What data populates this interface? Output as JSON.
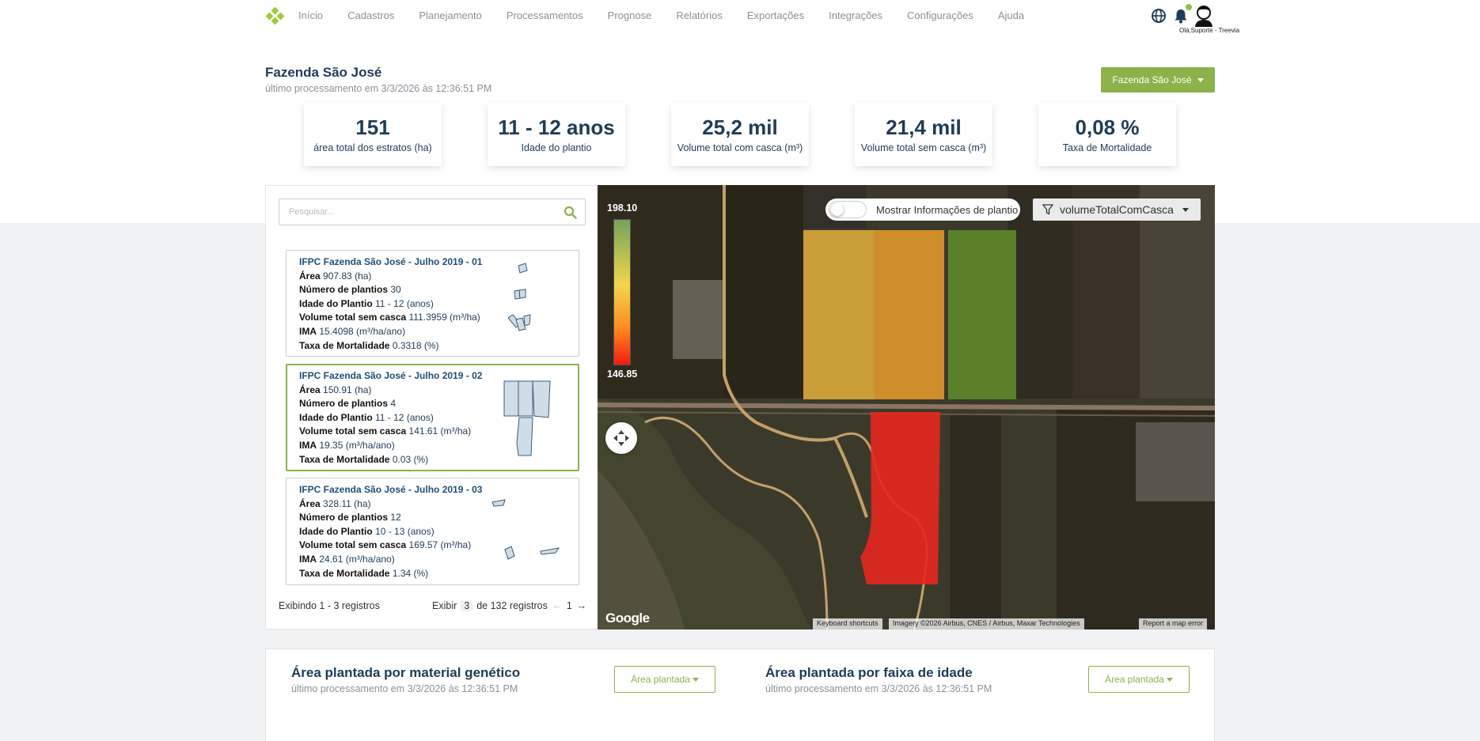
{
  "nav": {
    "items": [
      "Início",
      "Cadastros",
      "Planejamento",
      "Processamentos",
      "Prognose",
      "Relatórios",
      "Exportações",
      "Integrações",
      "Configurações",
      "Ajuda"
    ],
    "greeting": "Olá,Suporte - Treevia",
    "icons": [
      "logo-icon",
      "globe-icon",
      "bell-icon",
      "avatar-icon"
    ]
  },
  "header": {
    "title": "Fazenda São José",
    "subtitle": "último processamento em 3/3/2026 às 12:36:51 PM",
    "farm_selector": "Fazenda São José"
  },
  "stats": [
    {
      "value": "151",
      "label": "área total dos estratos (ha)"
    },
    {
      "value": "11 - 12 anos",
      "label": "Idade do plantio"
    },
    {
      "value": "25,2 mil",
      "label": "Volume total com casca (m³)"
    },
    {
      "value": "21,4 mil",
      "label": "Volume total sem casca (m³)"
    },
    {
      "value": "0,08 %",
      "label": "Taxa de Mortalidade"
    }
  ],
  "search": {
    "placeholder": "Pesquisar..."
  },
  "list": {
    "items": [
      {
        "title": "IFPC Fazenda São José - Julho 2019 - 01",
        "area": "907.83 (ha)",
        "plantios": "30",
        "idade": "11 - 12 (anos)",
        "volume": "111.3959 (m³/ha)",
        "ima": "15.4098 (m³/ha/ano)",
        "mortalidade": "0.3318 (%)",
        "selected": false
      },
      {
        "title": "IFPC Fazenda São José - Julho 2019 - 02",
        "area": "150.91 (ha)",
        "plantios": "4",
        "idade": "11 - 12 (anos)",
        "volume": "141.61 (m³/ha)",
        "ima": "19.35 (m³/ha/ano)",
        "mortalidade": "0.03 (%)",
        "selected": true
      },
      {
        "title": "IFPC Fazenda São José - Julho 2019 - 03",
        "area": "328.11 (ha)",
        "plantios": "12",
        "idade": "10 - 13 (anos)",
        "volume": "169.57 (m³/ha)",
        "ima": "24.61 (m³/ha/ano)",
        "mortalidade": "1.34 (%)",
        "selected": false
      }
    ],
    "labels": {
      "area": "Área",
      "plantios": "Número de plantios",
      "idade": "Idade do Plantio",
      "volume": "Volume total sem casca",
      "ima": "IMA",
      "mortalidade": "Taxa de Mortalidade"
    },
    "footer_showing": "Exibindo 1 - 3 registros",
    "footer_exibir": "Exibir",
    "page_size": "3",
    "footer_total": "de 132 registros",
    "page": "1"
  },
  "map": {
    "legend_max": "198.10",
    "legend_min": "146.85",
    "toggle_label": "Mostrar Informações de plantio",
    "filter": "volumeTotalComCasca",
    "google": "Google",
    "attrib_shortcuts": "Keyboard shortcuts",
    "attrib_imagery": "Imagery ©2026 Airbus, CNES / Airbus, Maxar Technologies",
    "attrib_report": "Report a map error",
    "field_colors": {
      "yellow": "#d9a83a",
      "orange": "#e39a2c",
      "green": "#5f8b2a",
      "red": "#e3281e"
    }
  },
  "lower": {
    "left_title": "Área plantada por material genético",
    "left_sub": "último processamento em 3/3/2026 às 12:36:51 PM",
    "left_btn": "Área plantada",
    "right_title": "Área plantada por faixa de idade",
    "right_sub": "último processamento em 3/3/2026 às 12:36:51 PM",
    "right_btn": "Área plantada"
  }
}
